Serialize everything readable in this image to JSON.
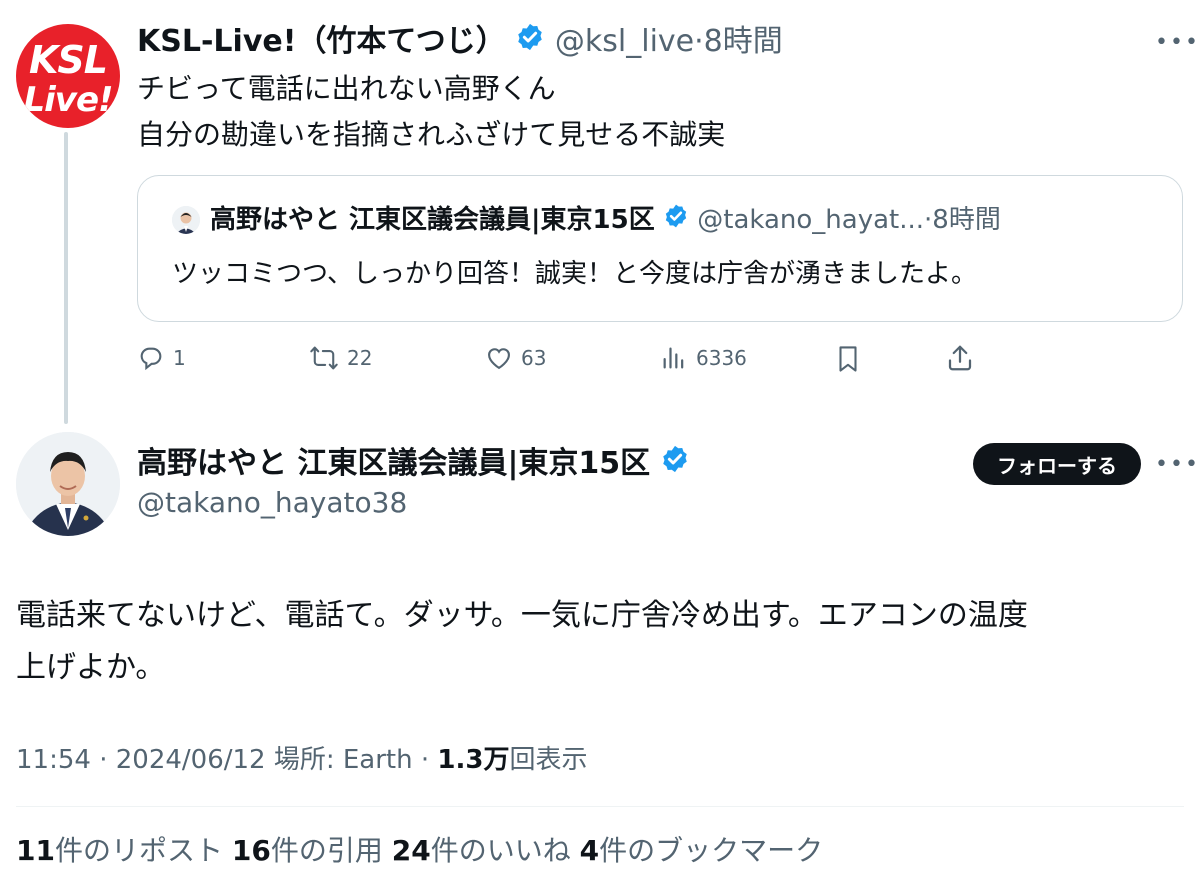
{
  "quoting_tweet": {
    "avatar_text_line1": "KSL",
    "avatar_text_line2": "Live!",
    "display_name": "KSL-Live!（竹本てつじ）",
    "handle": "@ksl_live",
    "separator": "·",
    "time": "8時間",
    "body_line1": "チビって電話に出れない高野くん",
    "body_line2": "自分の勘違いを指摘されふざけて見せる不誠実",
    "quoted": {
      "display_name": "高野はやと 江東区議会議員|東京15区",
      "handle": "@takano_hayat...",
      "separator": "·",
      "time": "8時間",
      "body": "ツッコミつつ、しっかり回答！誠実！と今度は庁舎が湧きましたよ。"
    },
    "actions": {
      "replies": "1",
      "reposts": "22",
      "likes": "63",
      "views": "6336"
    }
  },
  "main_tweet": {
    "display_name": "高野はやと 江東区議会議員|東京15区",
    "handle": "@takano_hayato38",
    "follow_label": "フォローする",
    "body_line1": "電話来てないけど、電話て。ダッサ。一気に庁舎冷め出す。エアコンの温度",
    "body_line2": "上げよか。",
    "meta": {
      "time": "11:54",
      "sep1": "·",
      "date": "2024/06/12",
      "location": "場所: Earth",
      "sep2": "·",
      "views_count": "1.3万",
      "views_label": "回表示"
    },
    "stats": {
      "reposts_count": "11",
      "reposts_label": "件のリポスト",
      "quotes_count": "16",
      "quotes_label": "件の引用",
      "likes_count": "24",
      "likes_label": "件のいいね",
      "bookmarks_count": "4",
      "bookmarks_label": "件のブックマーク"
    }
  },
  "colors": {
    "verified": "#1d9bf0",
    "ksl_red": "#e8212a",
    "muted": "#536471",
    "border": "#cfd9de"
  },
  "icons": [
    "verified-badge-icon",
    "reply-icon",
    "repost-icon",
    "like-icon",
    "views-icon",
    "bookmark-icon",
    "share-icon",
    "more-icon"
  ]
}
